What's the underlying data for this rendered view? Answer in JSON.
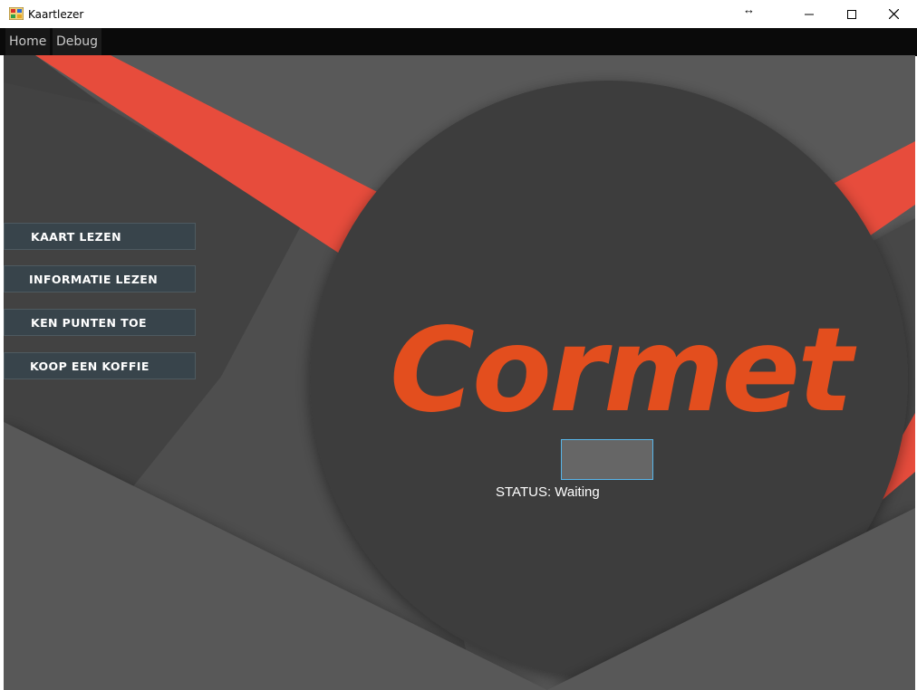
{
  "window": {
    "title": "Kaartlezer",
    "controls": [
      "minimize-icon",
      "maximize-icon",
      "close-icon"
    ],
    "resize_glyph": "↔"
  },
  "menu": {
    "items": [
      {
        "label": "Home"
      },
      {
        "label": "Debug"
      }
    ]
  },
  "sidebar": {
    "buttons": [
      {
        "label": "KAART LEZEN"
      },
      {
        "label": "INFORMATIE LEZEN"
      },
      {
        "label": "KEN PUNTEN TOE"
      },
      {
        "label": "KOOP EEN KOFFIE"
      }
    ]
  },
  "main": {
    "logo_text": "Cormet",
    "status_text": "STATUS: Waiting",
    "card_field_value": ""
  },
  "colors": {
    "accent_red": "#e74c3c",
    "logo_orange": "#e34e1e",
    "button_bg": "#38444b",
    "background_gray": "#5a5a5a",
    "circle_gray": "#3c3c3c",
    "field_border": "#58b6ea"
  }
}
